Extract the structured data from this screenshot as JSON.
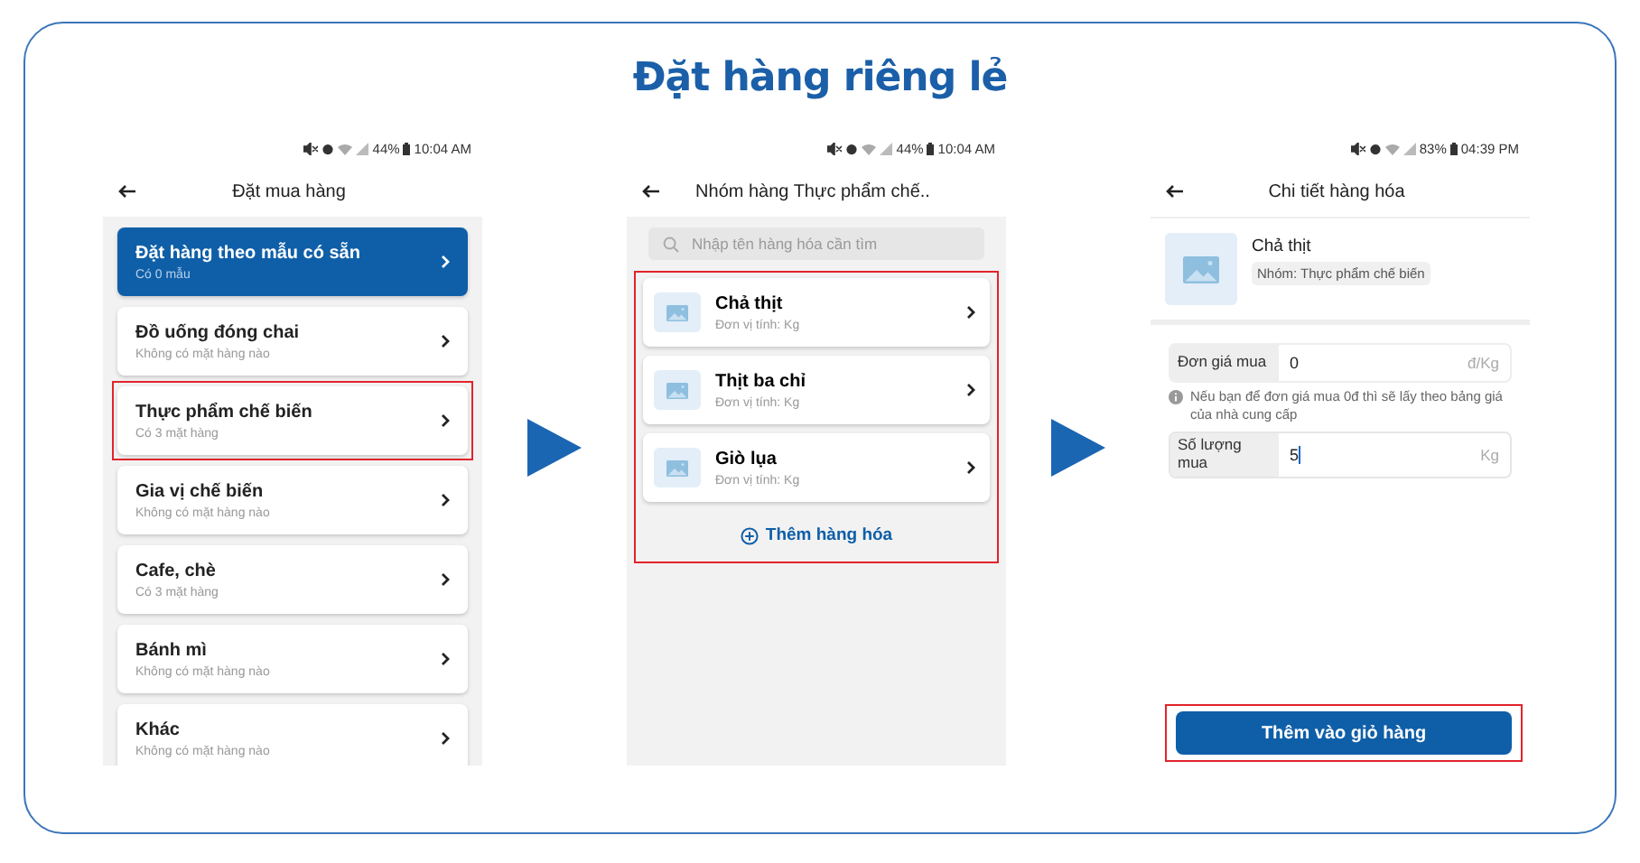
{
  "title": "Đặt hàng riêng lẻ",
  "screens": [
    {
      "kind": "category_list",
      "status": {
        "battery": "44%",
        "time": "10:04 AM"
      },
      "header": "Đặt mua hàng",
      "items": [
        {
          "name": "Đặt hàng theo mẫu có sẵn",
          "sub": "Có 0 mẫu",
          "selected": true,
          "highlighted": false
        },
        {
          "name": "Đồ uống đóng chai",
          "sub": "Không có mặt hàng nào",
          "selected": false,
          "highlighted": false
        },
        {
          "name": "Thực phẩm chế biến",
          "sub": "Có 3 mặt hàng",
          "selected": false,
          "highlighted": true
        },
        {
          "name": "Gia vị chế biến",
          "sub": "Không có mặt hàng nào",
          "selected": false,
          "highlighted": false
        },
        {
          "name": "Cafe, chè",
          "sub": "Có 3 mặt hàng",
          "selected": false,
          "highlighted": false
        },
        {
          "name": "Bánh mì",
          "sub": "Không có mặt hàng nào",
          "selected": false,
          "highlighted": false
        },
        {
          "name": "Khác",
          "sub": "Không có mặt hàng nào",
          "selected": false,
          "highlighted": false
        }
      ]
    },
    {
      "kind": "product_list",
      "status": {
        "battery": "44%",
        "time": "10:04 AM"
      },
      "header": "Nhóm hàng Thực phẩm chế..",
      "search": {
        "placeholder": "Nhập tên hàng hóa cần tìm"
      },
      "highlighted": true,
      "products": [
        {
          "name": "Chả thịt",
          "unit": "Đơn vị tính: Kg"
        },
        {
          "name": "Thịt ba chỉ",
          "unit": "Đơn vị tính: Kg"
        },
        {
          "name": "Giò lụa",
          "unit": "Đơn vị tính: Kg"
        }
      ],
      "add_button": "Thêm hàng hóa"
    },
    {
      "kind": "product_detail",
      "status": {
        "battery": "83%",
        "time": "04:39 PM"
      },
      "header": "Chi tiết hàng hóa",
      "product": {
        "name": "Chả thịt",
        "group": "Nhóm: Thực phẩm chế biến"
      },
      "fields": [
        {
          "label": "Đơn giá mua",
          "value": "0",
          "unit": "đ/Kg",
          "focused": false,
          "note": "Nếu bạn để đơn giá mua 0đ thì sẽ lấy theo bảng giá của nhà cung cấp"
        },
        {
          "label": "Số lượng mua",
          "value": "5",
          "unit": "Kg",
          "focused": true
        }
      ],
      "button": "Thêm vào giỏ hàng",
      "button_highlighted": true
    }
  ]
}
